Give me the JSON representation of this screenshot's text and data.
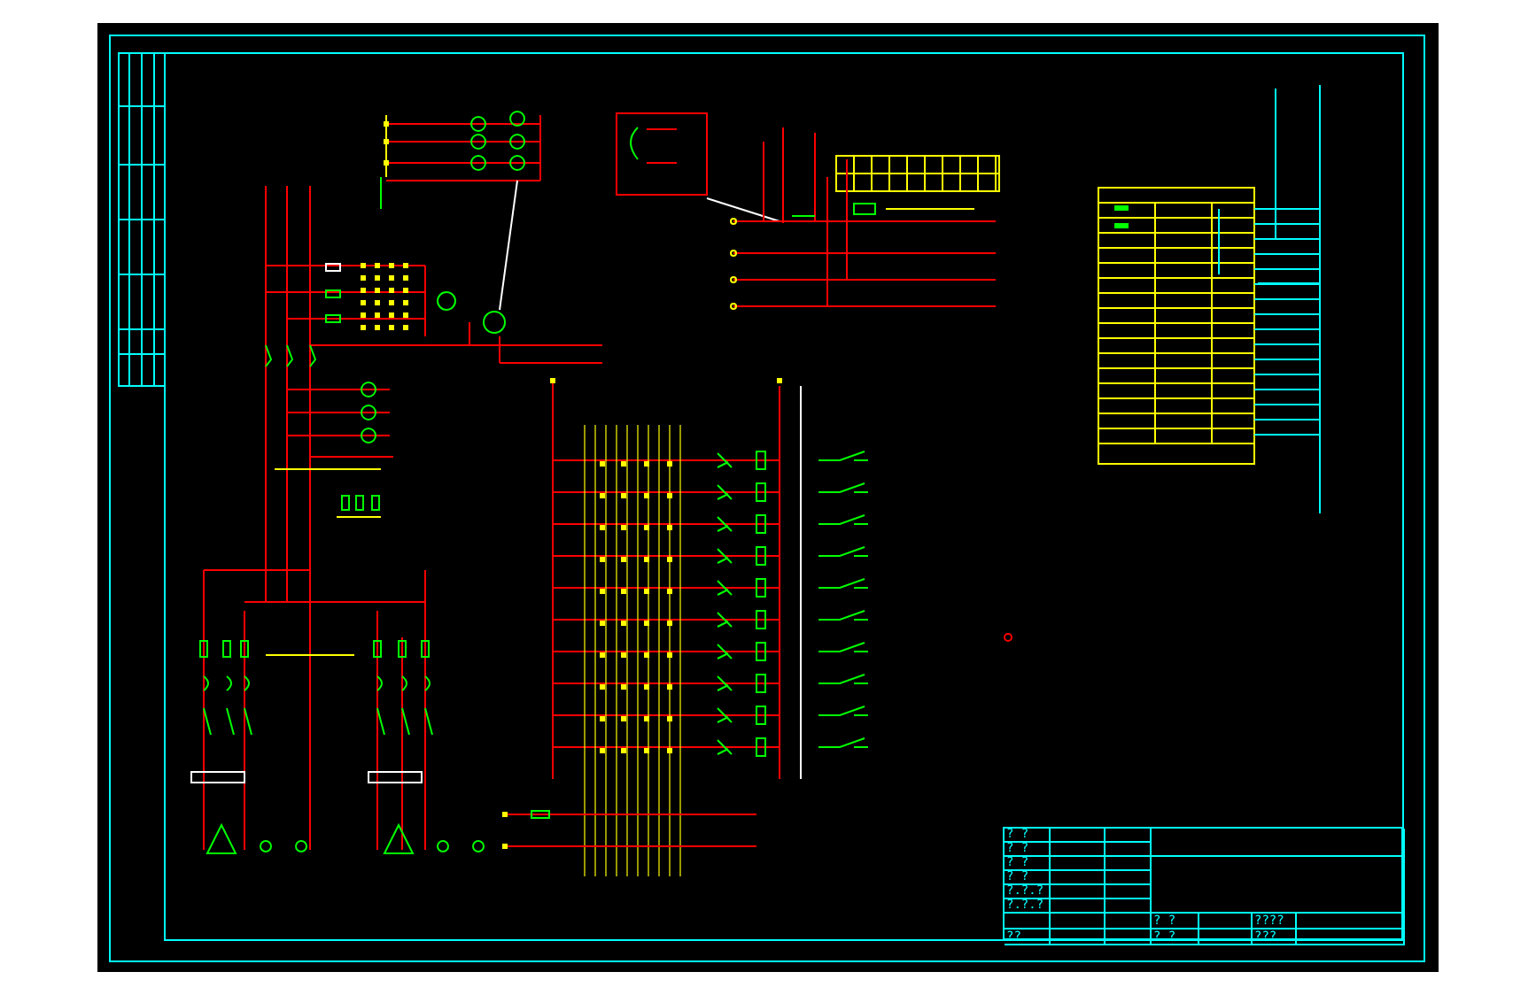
{
  "title_block": {
    "left_labels": [
      "? ?",
      "? ?",
      "? ?",
      "? ?",
      "?.?.?",
      "?.?.?"
    ],
    "bottom_row_1": {
      "label": "? ?",
      "code": "????"
    },
    "bottom_row_2": {
      "mark": "??",
      "label": "? ?",
      "code": "???"
    }
  }
}
